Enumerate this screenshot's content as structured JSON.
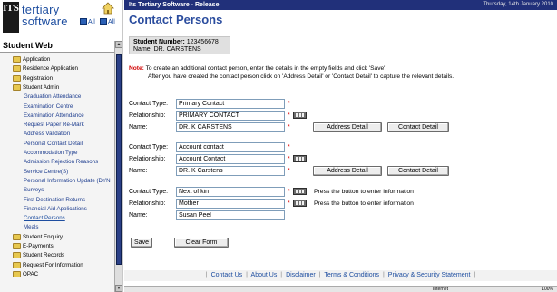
{
  "logo": {
    "brand": "ITS",
    "line1": "tertiary",
    "line2": "software"
  },
  "home": {
    "all1": "All",
    "all2": "All"
  },
  "sidebar": {
    "title": "Student Web",
    "items": [
      {
        "label": "Application",
        "type": "folder"
      },
      {
        "label": "Residence Application",
        "type": "folder"
      },
      {
        "label": "Registration",
        "type": "folder"
      },
      {
        "label": "Student Admin",
        "type": "folder"
      },
      {
        "label": "Graduation Attendance",
        "type": "sub"
      },
      {
        "label": "Examination Centre",
        "type": "sub"
      },
      {
        "label": "Examination Attendance",
        "type": "sub"
      },
      {
        "label": "Request Paper Re-Mark",
        "type": "sub"
      },
      {
        "label": "Address Validation",
        "type": "sub"
      },
      {
        "label": "Personal Contact Detail",
        "type": "sub"
      },
      {
        "label": "Accommodation Type",
        "type": "sub"
      },
      {
        "label": "Admission Rejection Reasons",
        "type": "sub"
      },
      {
        "label": "Service Centre(S)",
        "type": "sub"
      },
      {
        "label": "Personal Information Update (DYN",
        "type": "sub"
      },
      {
        "label": "Surveys",
        "type": "sub"
      },
      {
        "label": "First Destination Returns",
        "type": "sub"
      },
      {
        "label": "Financial Aid Applications",
        "type": "sub"
      },
      {
        "label": "Contact Persons",
        "type": "active"
      },
      {
        "label": "Meals",
        "type": "sub"
      },
      {
        "label": "Student Enquiry",
        "type": "folder"
      },
      {
        "label": "E-Payments",
        "type": "folder"
      },
      {
        "label": "Student Records",
        "type": "folder"
      },
      {
        "label": "Request For Information",
        "type": "folder"
      },
      {
        "label": "OPAC",
        "type": "folder"
      }
    ]
  },
  "topbar": {
    "app_title": "Its Tertiary Software - Release",
    "date": "Thursday, 14th January 2010"
  },
  "page": {
    "heading": "Contact Persons",
    "student_number_label": "Student Number:",
    "student_number": "123456678",
    "name_label": "Name:",
    "name": "DR. CARSTENS",
    "note_label": "Note:",
    "note_line1": "To create an additional contact person, enter the details in the empty fields and click 'Save'.",
    "note_line2": "After you have created the contact person click on 'Address Detail' or 'Contact Detail' to capture the relevant details."
  },
  "labels": {
    "contact_type": "Contact Type:",
    "relationship": "Relationship:",
    "name": "Name:"
  },
  "contacts": [
    {
      "contact_type": "Primary Contact",
      "relationship": "PRIMARY CONTACT",
      "name": "DR. K CARSTENS",
      "address_btn": "Address Detail",
      "contact_btn": "Contact Detail"
    },
    {
      "contact_type": "Account contact",
      "relationship": "Account Contact",
      "name": "DR. K Carstens",
      "address_btn": "Address Detail",
      "contact_btn": "Contact Detail"
    },
    {
      "contact_type": "Next of kin",
      "relationship": "Mother",
      "name": "Susan Peel",
      "hint": "Press the button to  enter information"
    }
  ],
  "buttons": {
    "save": "Save",
    "clear": "Clear Form"
  },
  "footer": {
    "links": [
      "Contact Us",
      "About Us",
      "Disclaimer",
      "Terms & Conditions",
      "Privacy & Security Statement"
    ]
  },
  "status": {
    "zone": "Internet",
    "zoom": "100%"
  },
  "colors": {
    "topbar": "#21307a",
    "heading": "#2a4c9e",
    "required": "#e00000",
    "link": "#1e4ea0"
  }
}
